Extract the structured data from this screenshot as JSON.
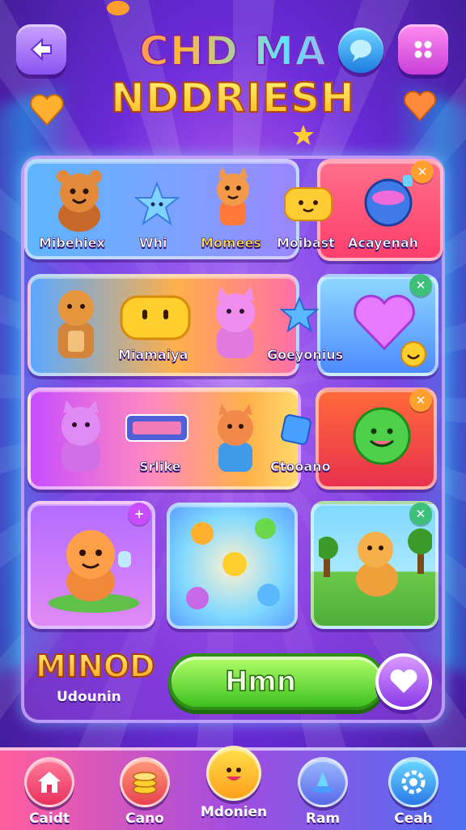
{
  "header": {
    "title_line1": "CHD MA",
    "title_line2": "NDDRIESH",
    "back_icon": "back-arrow-icon",
    "chat_icon": "chat-bubble-icon",
    "menu_icon": "grid-dots-icon"
  },
  "row1": {
    "items": [
      {
        "label": "Mibehiex",
        "icon": "bear-icon"
      },
      {
        "label": "Whi",
        "icon": "star-creature-icon"
      },
      {
        "label": "Momees",
        "icon": "fox-icon"
      },
      {
        "label": "Moibast",
        "icon": "slime-icon"
      },
      {
        "label": "Acayenah",
        "icon": "bomb-icon"
      }
    ]
  },
  "row2": {
    "labels": [
      "Miamaiya",
      "Goeyonius"
    ]
  },
  "row3": {
    "labels": [
      "Srlike",
      "Ctooano"
    ]
  },
  "bottom": {
    "mode_title": "MINOD",
    "mode_subtitle": "Udounin",
    "play_label": "Hmn"
  },
  "nav": {
    "items": [
      {
        "label": "Caidt",
        "icon": "home-icon"
      },
      {
        "label": "Cano",
        "icon": "coins-icon"
      },
      {
        "label": "Mdonien",
        "icon": "smiley-icon"
      },
      {
        "label": "Ram",
        "icon": "bell-icon"
      },
      {
        "label": "Ceah",
        "icon": "settings-icon"
      }
    ]
  },
  "colors": {
    "accent": "#8a52f0",
    "play": "#3fc020",
    "highlight": "#ffe24a"
  }
}
